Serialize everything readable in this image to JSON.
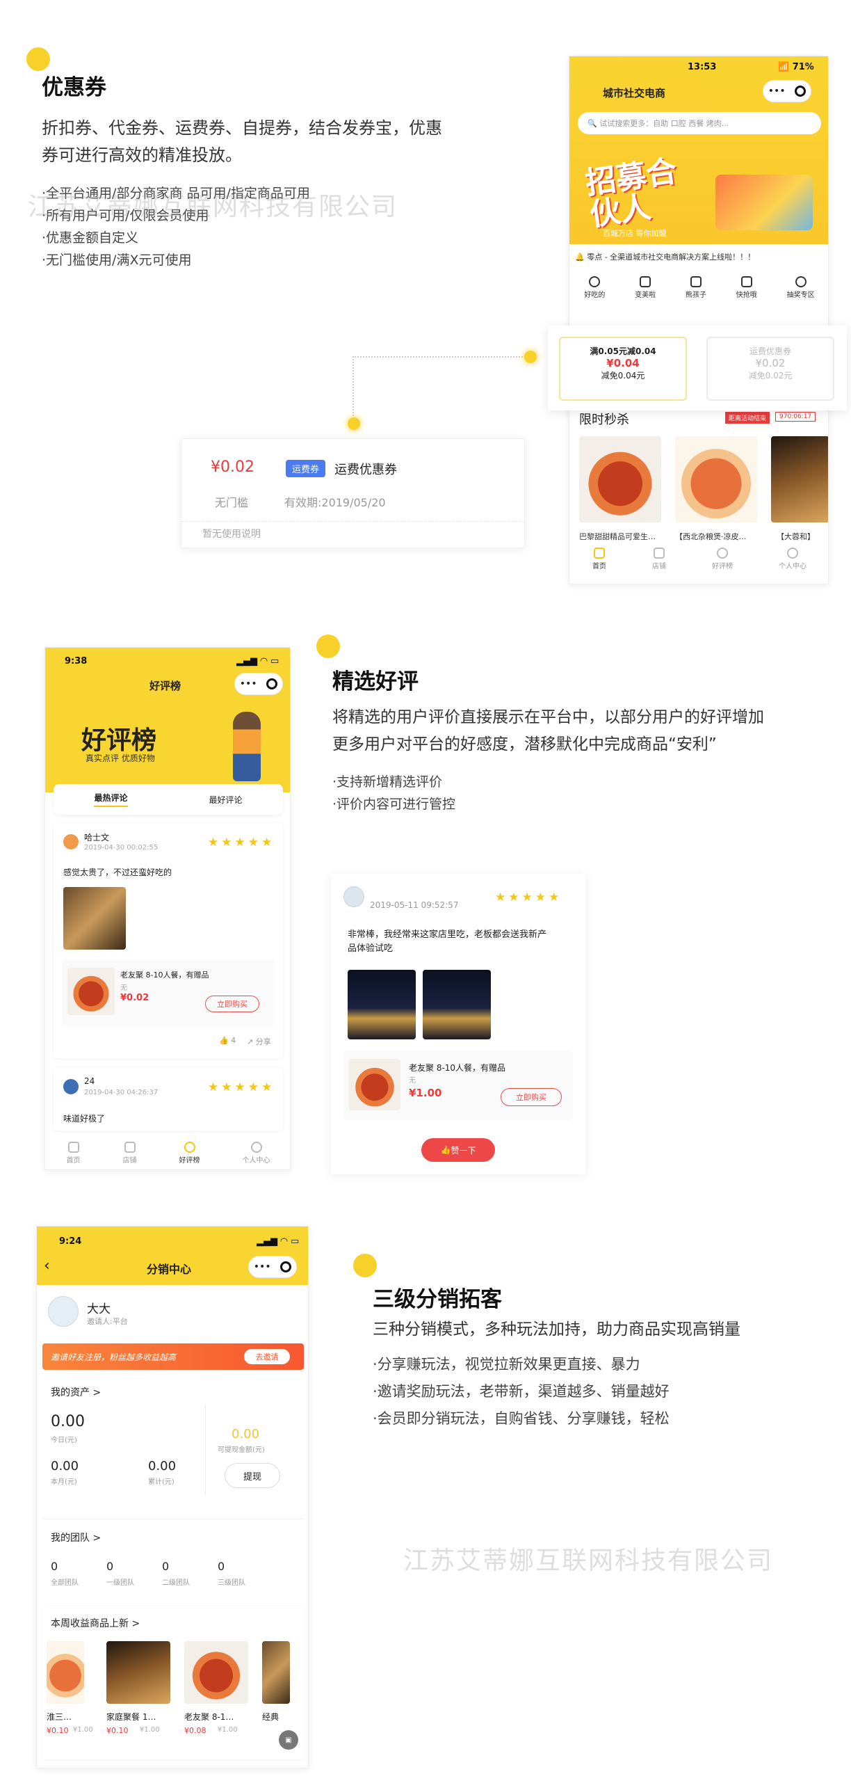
{
  "section1": {
    "title": "优惠券",
    "desc_line1": "折扣券、代金券、运费券、自提券，结合发券宝，优惠",
    "desc_line2": "券可进行高效的精准投放。",
    "bullets": [
      "·全平台通用/部分商家商   品可用/指定商品可用",
      "·所有用户可用/仅限会员使用",
      "·优惠金额自定义",
      "·无门槛使用/满X元可使用"
    ],
    "coupon_card": {
      "amount": "¥0.02",
      "tag": "运费券",
      "name": "运费优惠券",
      "threshold": "无门槛",
      "validity": "有效期:2019/05/20",
      "note": "暂无使用说明"
    },
    "phone": {
      "status_time": "13:53",
      "status_icons": "📶 71%",
      "nav_title": "城市社交电商",
      "capsule_dots": "•••",
      "search_placeholder": "试试搜索更多：自助 口腔 西餐 烤肉...",
      "banner_big": "招募合伙人",
      "banner_small": "百城万店 等你加盟",
      "notice": "零点 - 全渠道城市社交电商解决方案上线啦！！！",
      "categories": [
        "好吃的",
        "变美啦",
        "熊孩子",
        "快抢哦",
        "抽奖专区"
      ],
      "coupon1": {
        "l1": "满0.05元减0.04",
        "l2": "¥0.04",
        "l3": "减免0.04元"
      },
      "coupon2": {
        "l1": "运费优惠券",
        "l2": "¥0.02",
        "l3": "减免0.02元"
      },
      "flash_title": "限时秒杀",
      "flash_badge": "距离活动结束",
      "flash_timer": "970:06:17",
      "products": [
        "巴黎甜甜精品可爱生…",
        "【西北杂粮煲·凉皮…",
        "【大蓉和】"
      ],
      "tabbar": [
        "首页",
        "店铺",
        "好评榜",
        "个人中心"
      ]
    }
  },
  "section2": {
    "title": "精选好评",
    "desc_line1": "将精选的用户评价直接展示在平台中，以部分用户的好评增加",
    "desc_line2": "更多用户对平台的好感度，潜移默化中完成商品“安利”",
    "bullets": [
      "·支持新增精选评价",
      "·评价内容可进行管控"
    ],
    "phone": {
      "status_time": "9:38",
      "nav_title": "好评榜",
      "capsule_dots": "•••",
      "banner_big": "好评榜",
      "banner_small": "真实点评  优质好物",
      "tabs": [
        "最热评论",
        "最好评论"
      ],
      "review1": {
        "user": "哈士文",
        "time": "2019-04-30 00:02:55",
        "content": "感觉太贵了，不过还蛮好吃的",
        "product": "老友聚 8-10人餐，有赠品",
        "product_sub": "无",
        "price": "¥0.02",
        "buy": "立即购买",
        "likes": "4",
        "share": "分享"
      },
      "review2": {
        "user": "24",
        "time": "2019-04-30 04:26:37",
        "content": "味道好极了"
      },
      "tabbar": [
        "首页",
        "店铺",
        "好评榜",
        "个人中心"
      ]
    },
    "card": {
      "time": "2019-05-11 09:52:57",
      "content_line1": "非常棒，我经常来这家店里吃，老板都会送我新产",
      "content_line2": "品体验试吃",
      "product": "老友聚 8-10人餐，有赠品",
      "product_sub": "无",
      "price": "¥1.00",
      "buy": "立即购买",
      "like_btn": "赞一下"
    }
  },
  "section3": {
    "title": "三级分销拓客",
    "desc": "三种分销模式，多种玩法加持，助力商品实现高销量",
    "bullets": [
      "·分享赚玩法，视觉拉新效果更直接、暴力",
      "·邀请奖励玩法，老带新，渠道越多、销量越好",
      "·会员即分销玩法，自购省钱、分享赚钱，轻松"
    ],
    "phone": {
      "status_time": "9:24",
      "nav_title": "分销中心",
      "capsule_dots": "•••",
      "user_name": "大大",
      "user_sub": "邀请人:平台",
      "invite_banner": "邀请好友注册，粉丝越多收益越高",
      "invite_btn": "去邀请",
      "assets_title": "我的资产 >",
      "today_val": "0.00",
      "today_label": "今日(元)",
      "month_val": "0.00",
      "month_label": "本月(元)",
      "total_val": "0.00",
      "total_label": "累计(元)",
      "withdrawable_val": "0.00",
      "withdrawable_label": "可提现金额(元)",
      "withdraw_btn": "提现",
      "team_title": "我的团队 >",
      "team": [
        {
          "v": "0",
          "l": "全部团队"
        },
        {
          "v": "0",
          "l": "一级团队"
        },
        {
          "v": "0",
          "l": "二级团队"
        },
        {
          "v": "0",
          "l": "三级团队"
        }
      ],
      "weekly_title": "本周收益商品上新 >",
      "weekly": [
        {
          "name": "淮三…",
          "price": "¥0.10",
          "orig": "¥1.00"
        },
        {
          "name": "家庭聚餐 1…",
          "price": "¥0.10",
          "orig": "¥1.00"
        },
        {
          "name": "老友聚 8-1…",
          "price": "¥0.08",
          "orig": "¥1.00"
        },
        {
          "name": "经典",
          "price": "",
          "orig": ""
        }
      ]
    }
  },
  "watermarks": [
    "江苏艾蒂娜互联网科技有限公司",
    "江苏艾蒂娜互联网科技有限公司"
  ],
  "colors": {
    "brand_yellow": "#f9d531",
    "price_red": "#e83b3b",
    "tag_blue": "#4a7cf0"
  }
}
